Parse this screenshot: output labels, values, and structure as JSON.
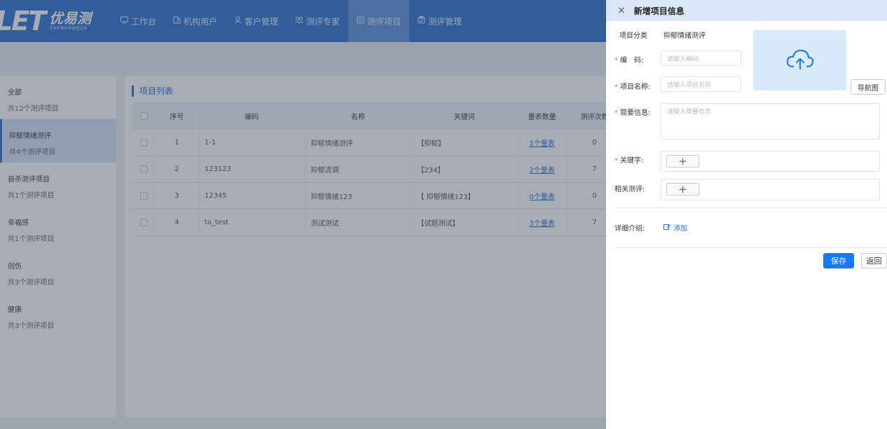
{
  "header": {
    "logo_mark": "LET",
    "logo_name": "优易测",
    "logo_slogan": "专业的测评系统供应商",
    "nav": [
      {
        "label": "工作台",
        "icon": "monitor-icon"
      },
      {
        "label": "机构用户",
        "icon": "building-icon"
      },
      {
        "label": "客户管理",
        "icon": "user-icon"
      },
      {
        "label": "测评专家",
        "icon": "group-icon"
      },
      {
        "label": "测评项目",
        "icon": "document-icon",
        "active": true
      },
      {
        "label": "测评管理",
        "icon": "clipboard-icon"
      }
    ]
  },
  "sidebar": {
    "categories": [
      {
        "name": "全部",
        "count": "共12个测评项目"
      },
      {
        "name": "抑郁情绪测评",
        "count": "共4个测评项目",
        "active": true
      },
      {
        "name": "自杀测评项目",
        "count": "共1个测评项目"
      },
      {
        "name": "幸福感",
        "count": "共1个测评项目"
      },
      {
        "name": "创伤",
        "count": "共3个测评项目"
      },
      {
        "name": "健康",
        "count": "共3个测评项目"
      }
    ]
  },
  "main": {
    "title": "项目列表",
    "columns": [
      "序号",
      "编码",
      "名称",
      "关键词",
      "量表数量",
      "测评次数"
    ],
    "rows": [
      {
        "no": "1",
        "code": "1-1",
        "name": "抑郁情绪测评",
        "keywords": "【抑郁】",
        "scales": "1个量表",
        "times": "0"
      },
      {
        "no": "2",
        "code": "123123",
        "name": "抑郁流调",
        "keywords": "【234】",
        "scales": "2个量表",
        "times": "7"
      },
      {
        "no": "3",
        "code": "12345",
        "name": "抑郁情绪123",
        "keywords": "【 抑郁情绪123】",
        "scales": "0个量表",
        "times": "0"
      },
      {
        "no": "4",
        "code": "ta_test",
        "name": "测试测试",
        "keywords": "【试题测试】",
        "scales": "3个量表",
        "times": "7"
      }
    ]
  },
  "drawer": {
    "title": "新增项目信息",
    "category_label": "项目分类",
    "category_value": "抑郁情绪测评",
    "code_label": "编　码:",
    "code_placeholder": "请输入编码",
    "name_label": "项目名称:",
    "name_placeholder": "请输入项目名称",
    "nav_image_button": "导航图",
    "brief_label": "简要信息:",
    "brief_placeholder": "请输入简要信息",
    "keyword_label": "关键字:",
    "related_label": "相关测评:",
    "detail_label": "详细介绍:",
    "detail_add": "添加",
    "save": "保存",
    "back": "返回",
    "required_mark": "*",
    "plus": "+",
    "close": "×"
  },
  "colors": {
    "primary": "#2a6fcf",
    "save_button": "#1677ff",
    "upload_bg": "#d8ebfb"
  }
}
